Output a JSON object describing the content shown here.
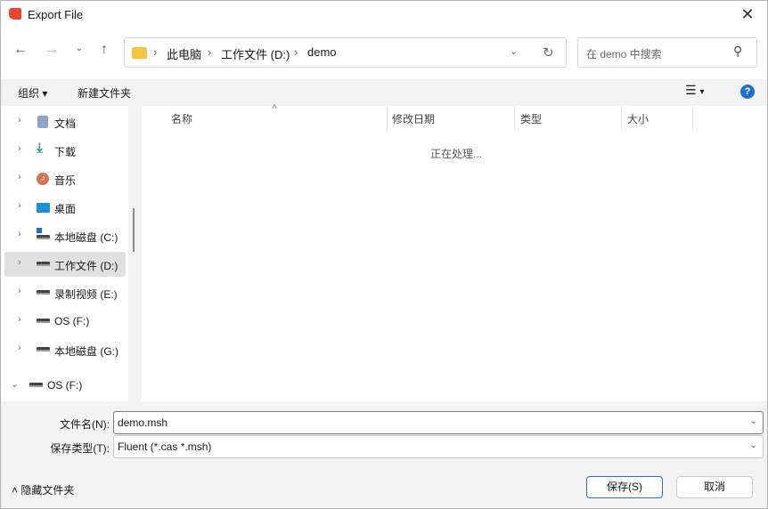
{
  "window": {
    "title": "Export File"
  },
  "nav": {
    "path": [
      "此电脑",
      "工作文件 (D:)",
      "demo"
    ],
    "search_placeholder": "在 demo 中搜索"
  },
  "toolbar": {
    "organize": "组织",
    "new_folder": "新建文件夹"
  },
  "sidebar": {
    "items": [
      {
        "label": "文档",
        "icon": "documents-icon"
      },
      {
        "label": "下载",
        "icon": "download-icon"
      },
      {
        "label": "音乐",
        "icon": "music-icon"
      },
      {
        "label": "桌面",
        "icon": "desktop-icon"
      },
      {
        "label": "本地磁盘 (C:)",
        "icon": "windows-drive-icon"
      },
      {
        "label": "工作文件 (D:)",
        "icon": "drive-icon",
        "selected": true
      },
      {
        "label": "录制视频 (E:)",
        "icon": "drive-icon"
      },
      {
        "label": "OS (F:)",
        "icon": "drive-icon"
      },
      {
        "label": "本地磁盘 (G:)",
        "icon": "drive-icon"
      },
      {
        "label": "OS (F:)",
        "icon": "drive-icon",
        "expanded": true
      }
    ]
  },
  "columns": [
    "名称",
    "修改日期",
    "类型",
    "大小"
  ],
  "status": "正在处理...",
  "form": {
    "filename_label": "文件名(N):",
    "filename": "demo.msh",
    "type_label": "保存类型(T):",
    "type": "Fluent (*.cas *.msh)"
  },
  "footer": {
    "hide_folders": "隐藏文件夹",
    "save": "保存(S)",
    "cancel": "取消"
  }
}
